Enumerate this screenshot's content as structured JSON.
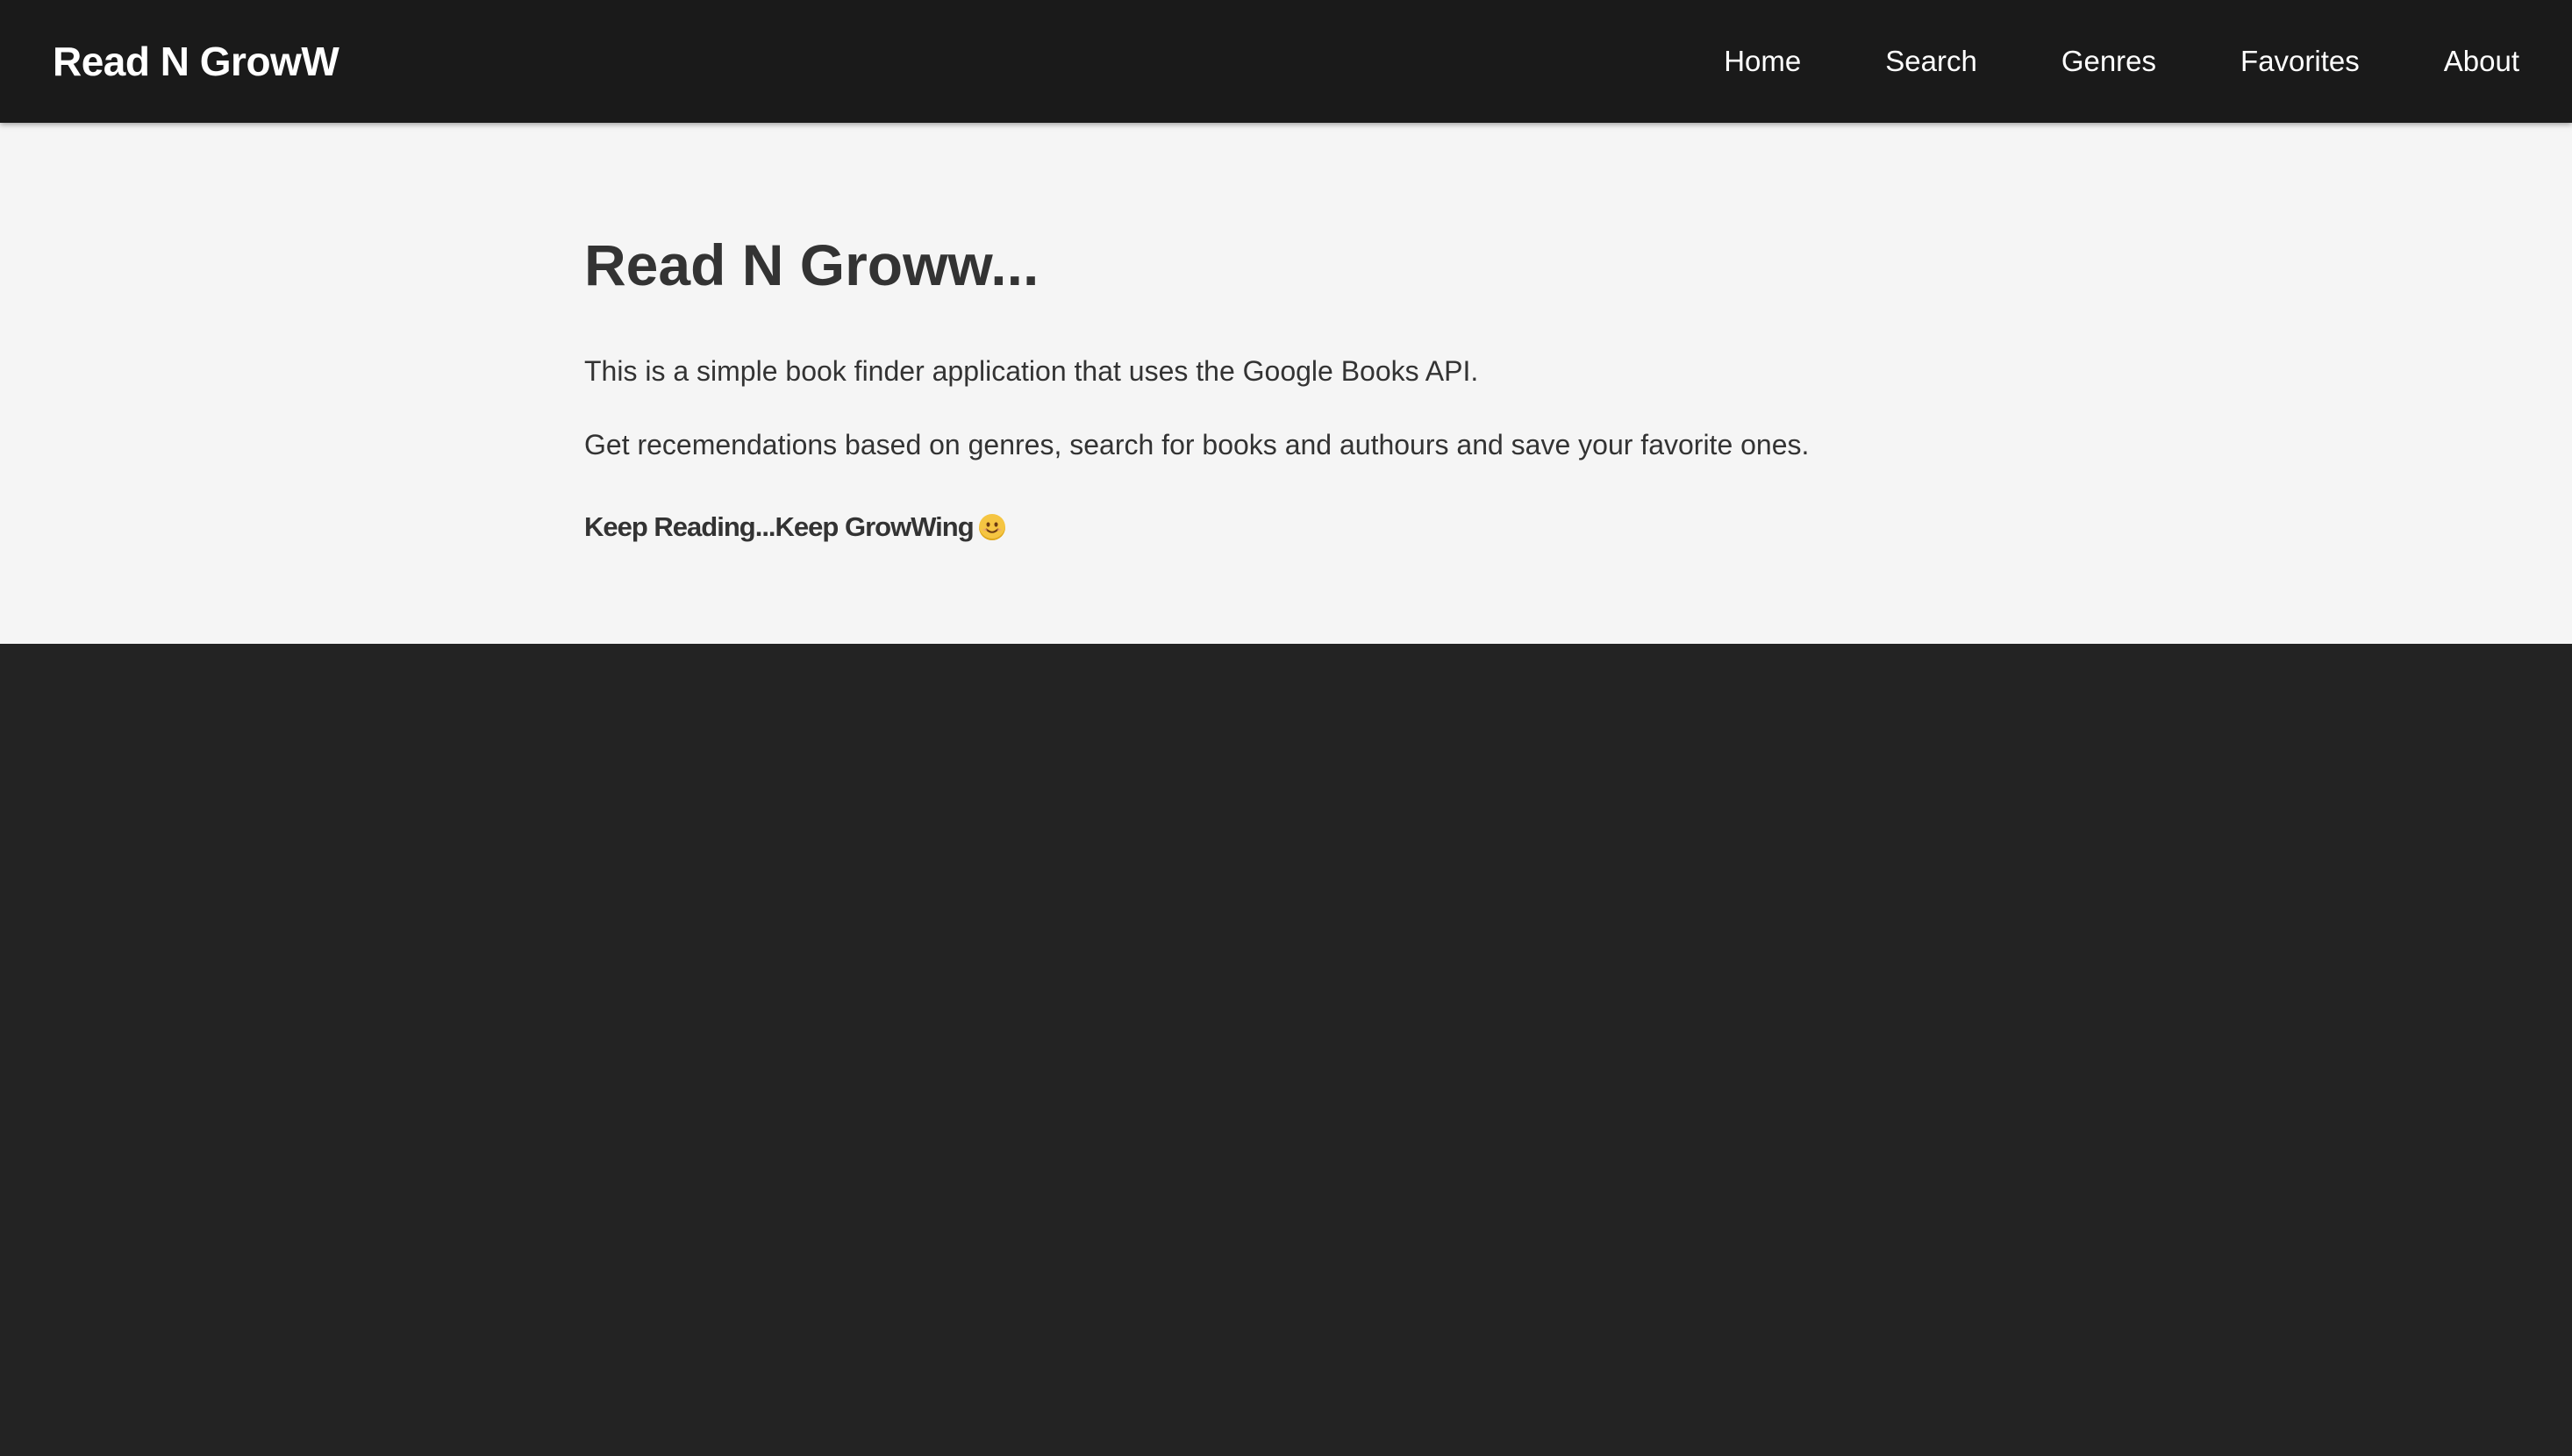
{
  "header": {
    "brand": "Read N GrowW",
    "nav": [
      {
        "label": "Home"
      },
      {
        "label": "Search"
      },
      {
        "label": "Genres"
      },
      {
        "label": "Favorites"
      },
      {
        "label": "About"
      }
    ]
  },
  "main": {
    "title": "Read N Groww...",
    "paragraphs": [
      "This is a simple book finder application that uses the Google Books API.",
      "Get recemendations based on genres, search for books and authours and save your favorite ones."
    ],
    "tagline": "Keep Reading...Keep GrowWing",
    "tagline_icon": "smile-icon"
  },
  "colors": {
    "navbar_bg": "#1a1a1a",
    "content_bg": "#f5f5f5",
    "page_bg": "#232323",
    "text": "#333333",
    "nav_text": "#ffffff"
  }
}
